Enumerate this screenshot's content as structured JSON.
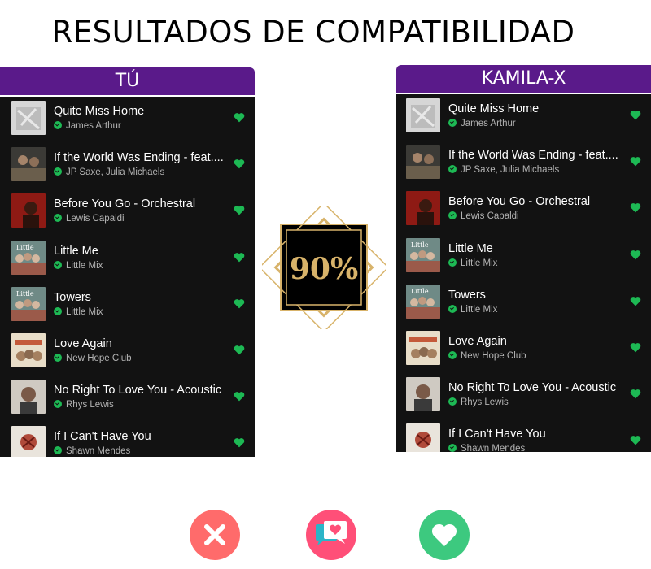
{
  "title": "RESULTADOS DE COMPATIBILIDAD",
  "score": "90%",
  "left_panel": {
    "header": "TÚ",
    "songs": [
      {
        "title": "Quite Miss Home",
        "artist": "James Arthur"
      },
      {
        "title": "If the World Was Ending - feat....",
        "artist": "JP Saxe, Julia Michaels"
      },
      {
        "title": "Before You Go - Orchestral",
        "artist": "Lewis Capaldi"
      },
      {
        "title": "Little Me",
        "artist": "Little Mix"
      },
      {
        "title": "Towers",
        "artist": "Little Mix"
      },
      {
        "title": "Love Again",
        "artist": "New Hope Club"
      },
      {
        "title": "No Right To Love You - Acoustic",
        "artist": "Rhys Lewis"
      },
      {
        "title": "If I Can't Have You",
        "artist": "Shawn Mendes"
      }
    ]
  },
  "right_panel": {
    "header": "KAMILA-X",
    "songs": [
      {
        "title": "Quite Miss Home",
        "artist": "James Arthur"
      },
      {
        "title": "If the World Was Ending - feat....",
        "artist": "JP Saxe, Julia Michaels"
      },
      {
        "title": "Before You Go - Orchestral",
        "artist": "Lewis Capaldi"
      },
      {
        "title": "Little Me",
        "artist": "Little Mix"
      },
      {
        "title": "Towers",
        "artist": "Little Mix"
      },
      {
        "title": "Love Again",
        "artist": "New Hope Club"
      },
      {
        "title": "No Right To Love You - Acoustic",
        "artist": "Rhys Lewis"
      },
      {
        "title": "If I Can't Have You",
        "artist": "Shawn Mendes"
      }
    ]
  },
  "colors": {
    "header_purple": "#5a1a8a",
    "list_bg": "#121212",
    "liked_green": "#1db954",
    "nope_red": "#ff6b6b",
    "chat_pink": "#ff4f78",
    "like_green": "#3dc97f",
    "badge_gold": "#d8b36a"
  },
  "icons": {
    "liked": "heart-icon",
    "downloaded": "download-icon",
    "nope": "close-icon",
    "chat": "chat-heart-icon",
    "like": "heart-icon"
  }
}
